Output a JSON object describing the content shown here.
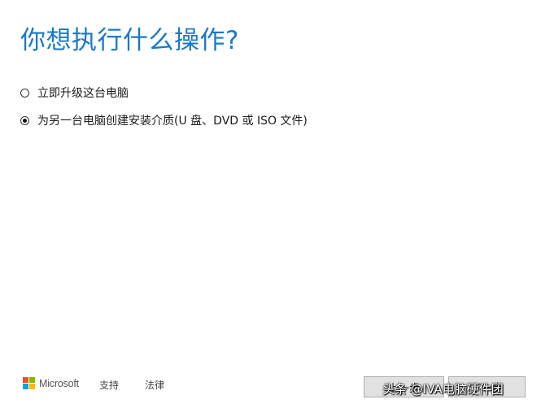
{
  "page": {
    "title": "你想执行什么操作?"
  },
  "options": [
    {
      "label": "立即升级这台电脑",
      "selected": false
    },
    {
      "label": "为另一台电脑创建安装介质(U 盘、DVD 或 ISO 文件)",
      "selected": true
    }
  ],
  "footer": {
    "brand": "Microsoft",
    "support_label": "支持",
    "legal_label": "法律",
    "back_label": "上一步",
    "next_label": "下一步",
    "logo_colors": [
      "#f25022",
      "#7fba00",
      "#00a4ef",
      "#ffb900"
    ],
    "watermark": "头条 @IVA电脑硬件团"
  },
  "colors": {
    "title": "#1979ca"
  }
}
